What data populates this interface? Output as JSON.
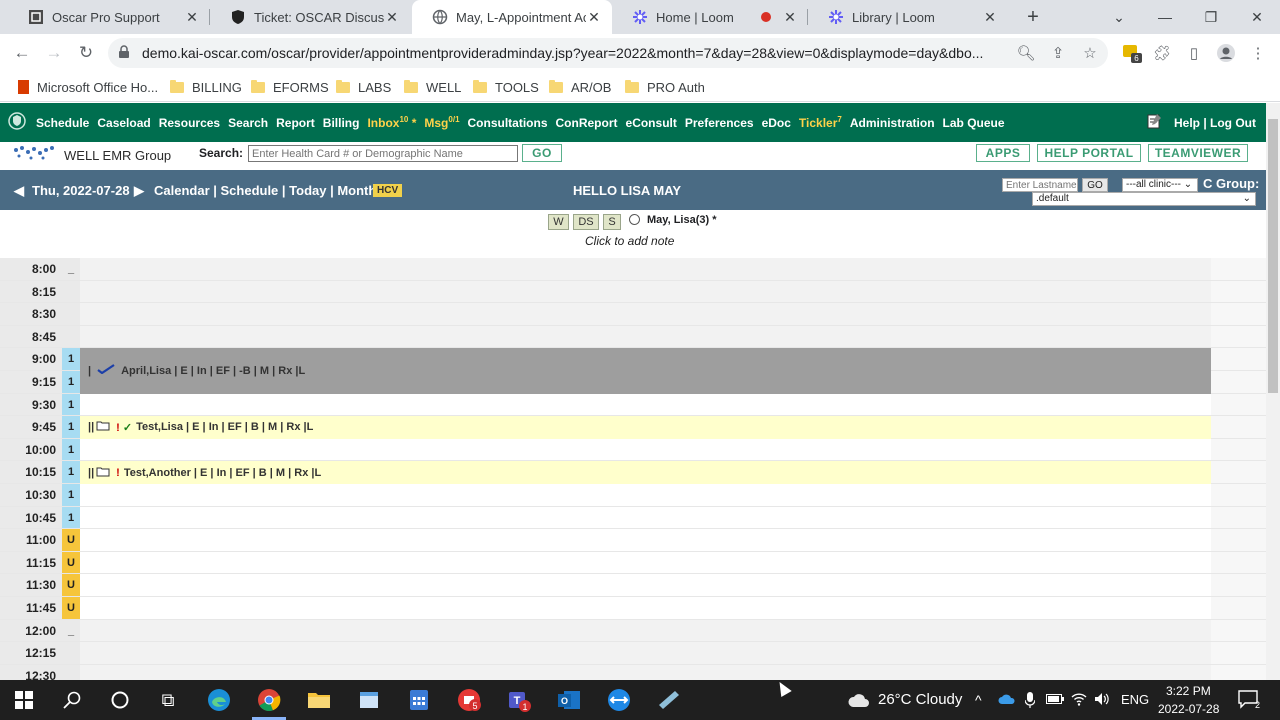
{
  "browser": {
    "tabs": [
      {
        "title": "Oscar Pro Support",
        "icon": "oscar-icon"
      },
      {
        "title": "Ticket: OSCAR Discussion",
        "icon": "shield-icon"
      },
      {
        "title": "May, L-Appointment Acc",
        "icon": "globe-icon"
      },
      {
        "title": "Home | Loom",
        "icon": "loom-icon"
      },
      {
        "title": "Library | Loom",
        "icon": "loom-icon"
      }
    ],
    "url": "demo.kai-oscar.com/oscar/provider/appointmentprovideradminday.jsp?year=2022&month=7&day=28&view=0&displaymode=day&dbo...",
    "extension_badge": "6",
    "bookmarks": [
      "Microsoft Office Ho...",
      "BILLING",
      "EFORMS",
      "LABS",
      "WELL",
      "TOOLS",
      "AR/OB",
      "PRO Auth"
    ]
  },
  "oscar_nav": {
    "items": [
      "Schedule",
      "Caseload",
      "Resources",
      "Search",
      "Report",
      "Billing"
    ],
    "inbox": {
      "label": "Inbox",
      "count": "10",
      "star": "*"
    },
    "msg": {
      "label": "Msg",
      "count": "0/1"
    },
    "items2": [
      "Consultations",
      "ConReport",
      "eConsult",
      "Preferences",
      "eDoc"
    ],
    "tickler": {
      "label": "Tickler",
      "count": "7"
    },
    "items3": [
      "Administration",
      "Lab Queue"
    ],
    "help": "Help | Log Out"
  },
  "search_row": {
    "logo": "WELL EMR Group",
    "label": "Search:",
    "placeholder": "Enter Health Card # or Demographic Name",
    "go": "GO",
    "buttons": [
      "APPS",
      "HELP PORTAL",
      "TEAMVIEWER"
    ]
  },
  "date_bar": {
    "date": "Thu, 2022-07-28",
    "links": "Calendar | Schedule | Today | Month",
    "hcv": "HCV",
    "greeting": "HELLO LISA MAY",
    "lastname_placeholder": "Enter Lastname",
    "go": "GO",
    "clinic_select": "---all clinic---",
    "group_label": "C Group:",
    "group_value": ".default"
  },
  "provider": {
    "view_buttons": [
      "W",
      "DS",
      "S"
    ],
    "name": "May, Lisa(3) *",
    "note": "Click to add note"
  },
  "schedule": {
    "rows": [
      {
        "time": "8:00",
        "marker": "_"
      },
      {
        "time": "8:15",
        "marker": ""
      },
      {
        "time": "8:30",
        "marker": ""
      },
      {
        "time": "8:45",
        "marker": ""
      },
      {
        "time": "9:00",
        "marker": "1"
      },
      {
        "time": "9:15",
        "marker": "1"
      },
      {
        "time": "9:30",
        "marker": "1"
      },
      {
        "time": "9:45",
        "marker": "1"
      },
      {
        "time": "10:00",
        "marker": "1"
      },
      {
        "time": "10:15",
        "marker": "1"
      },
      {
        "time": "10:30",
        "marker": "1"
      },
      {
        "time": "10:45",
        "marker": "1"
      },
      {
        "time": "11:00",
        "marker": "U"
      },
      {
        "time": "11:15",
        "marker": "U"
      },
      {
        "time": "11:30",
        "marker": "U"
      },
      {
        "time": "11:45",
        "marker": "U"
      },
      {
        "time": "12:00",
        "marker": "_"
      },
      {
        "time": "12:15",
        "marker": ""
      },
      {
        "time": "12:30",
        "marker": ""
      }
    ],
    "appointments": [
      {
        "text": "April,Lisa | E | In | EF | -B | M | Rx |L",
        "prefix": "|"
      },
      {
        "text": "Test,Lisa | E | In | EF | B | M | Rx |L",
        "prefix": "|| ",
        "flag": "! ✓"
      },
      {
        "text": "Test,Another | E | In | EF | B | M | Rx |L",
        "prefix": "|| ",
        "flag": "!"
      }
    ]
  },
  "taskbar": {
    "weather": "26°C  Cloudy",
    "lang": "ENG",
    "time": "3:22 PM",
    "date": "2022-07-28",
    "notif_count": "2",
    "teams_badge": "1",
    "chrome_badge": "5"
  },
  "colors": {
    "nav_bg": "#006e4f",
    "datebar_bg": "#4a6b84",
    "accent_yellow": "#ffd24a",
    "blue_marker": "#a7dcf2",
    "orange_marker": "#f6c53b"
  }
}
